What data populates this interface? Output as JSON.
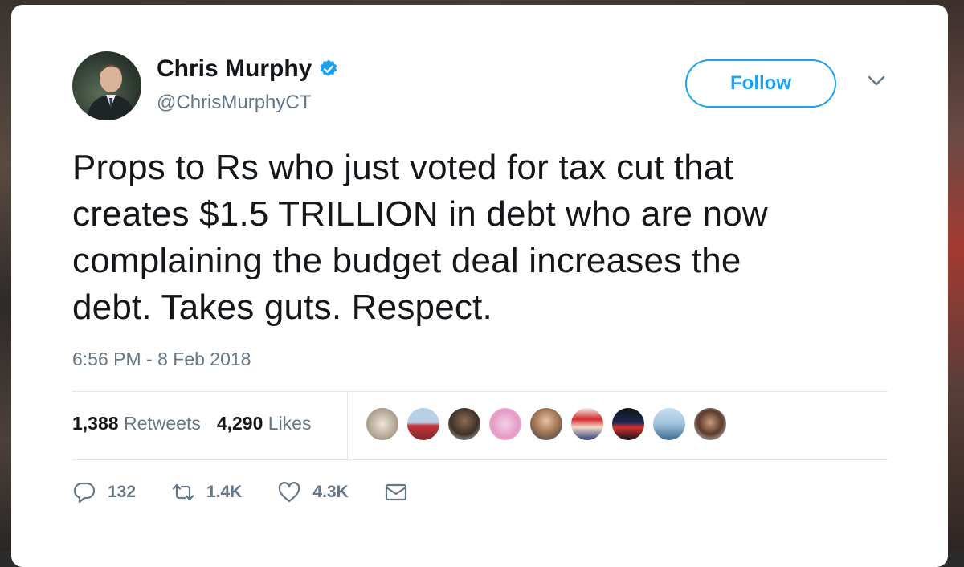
{
  "tweet": {
    "author_name": "Chris Murphy",
    "handle": "@ChrisMurphyCT",
    "follow_label": "Follow",
    "text_lines": [
      "Props to Rs who just voted for tax cut that",
      "creates $1.5 TRILLION in debt who are now",
      "complaining the budget deal increases the",
      "debt. Takes guts. Respect."
    ],
    "timestamp": "6:56 PM - 8 Feb 2018"
  },
  "stats": {
    "retweets_count": "1,388",
    "retweets_label": "Retweets",
    "likes_count": "4,290",
    "likes_label": "Likes"
  },
  "actions": {
    "reply_count": "132",
    "retweet_count": "1.4K",
    "like_count": "4.3K"
  },
  "colors": {
    "accent": "#1da1f2",
    "text": "#14171a",
    "muted": "#657786"
  },
  "icons": [
    "verified-badge-icon",
    "chevron-down-icon",
    "reply-icon",
    "retweet-icon",
    "heart-icon",
    "envelope-icon"
  ]
}
